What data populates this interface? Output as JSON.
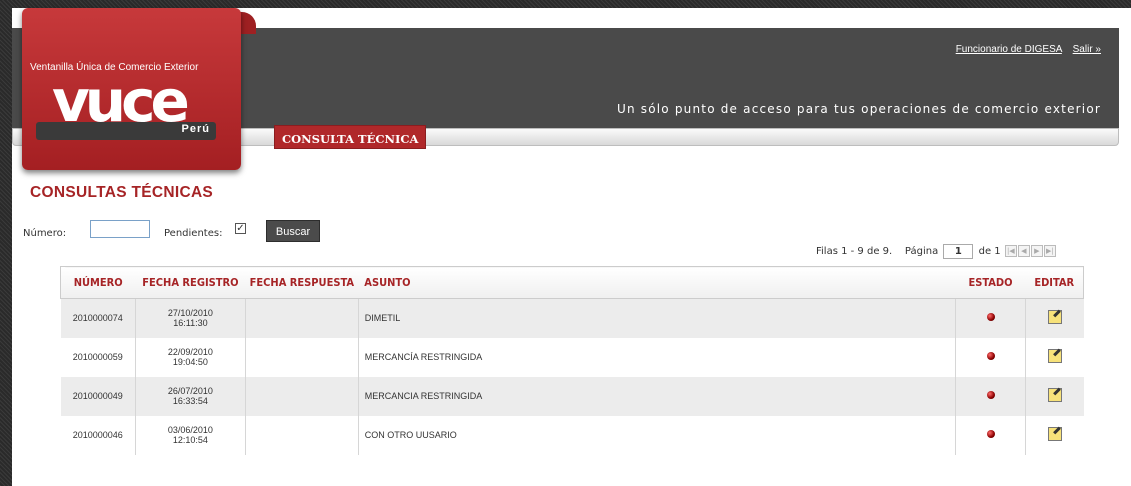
{
  "logo": {
    "subtitle": "Ventanilla Única de Comercio Exterior",
    "brand": "vuce",
    "country": "Perú"
  },
  "header": {
    "user_link": "Funcionario de DIGESA",
    "logout_link": "Salir »",
    "tagline": "Un sólo punto de acceso para tus operaciones de comercio exterior"
  },
  "nav": {
    "active_tab": "CONSULTA TÉCNICA"
  },
  "page": {
    "title": "CONSULTAS TÉCNICAS"
  },
  "search": {
    "numero_label": "Número:",
    "numero_value": "",
    "pendientes_label": "Pendientes:",
    "pendientes_checked": true,
    "button": "Buscar"
  },
  "pager": {
    "rows_text": "Filas 1 - 9 de 9.",
    "page_label": "Página",
    "page_value": "1",
    "of_text": "de 1"
  },
  "table": {
    "headers": [
      "NÚMERO",
      "FECHA REGISTRO",
      "FECHA RESPUESTA",
      "ASUNTO",
      "ESTADO",
      "EDITAR"
    ],
    "rows": [
      {
        "numero": "2010000074",
        "fecha": "27/10/2010",
        "hora": "16:11:30",
        "respuesta": "",
        "asunto": "DIMETIL"
      },
      {
        "numero": "2010000059",
        "fecha": "22/09/2010",
        "hora": "19:04:50",
        "respuesta": "",
        "asunto": "MERCANCÍA RESTRINGIDA"
      },
      {
        "numero": "2010000049",
        "fecha": "26/07/2010",
        "hora": "16:33:54",
        "respuesta": "",
        "asunto": "MERCANCIA RESTRINGIDA"
      },
      {
        "numero": "2010000046",
        "fecha": "03/06/2010",
        "hora": "12:10:54",
        "respuesta": "",
        "asunto": "CON OTRO UUSARIO"
      }
    ]
  },
  "colors": {
    "brand_red": "#b0282a",
    "header_gray": "#4a4a4a",
    "status_dot": "#8a0000"
  }
}
